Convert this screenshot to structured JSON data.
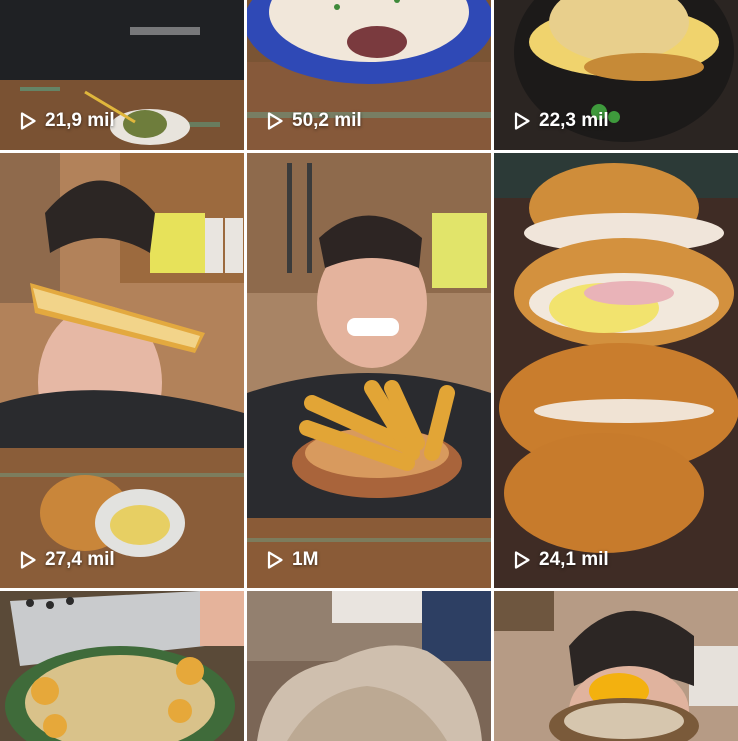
{
  "grid": {
    "tiles": [
      {
        "views": "21,9 mil"
      },
      {
        "views": "50,2 mil"
      },
      {
        "views": "22,3 mil"
      },
      {
        "views": "27,4 mil"
      },
      {
        "views": "1M"
      },
      {
        "views": "24,1 mil"
      },
      {
        "views": ""
      },
      {
        "views": ""
      },
      {
        "views": ""
      }
    ]
  },
  "icons": {
    "play": "play-outline-icon"
  },
  "colors": {
    "overlay_text": "#ffffff",
    "wood": "#8a5a32",
    "fried_crust": "#c9822f"
  }
}
